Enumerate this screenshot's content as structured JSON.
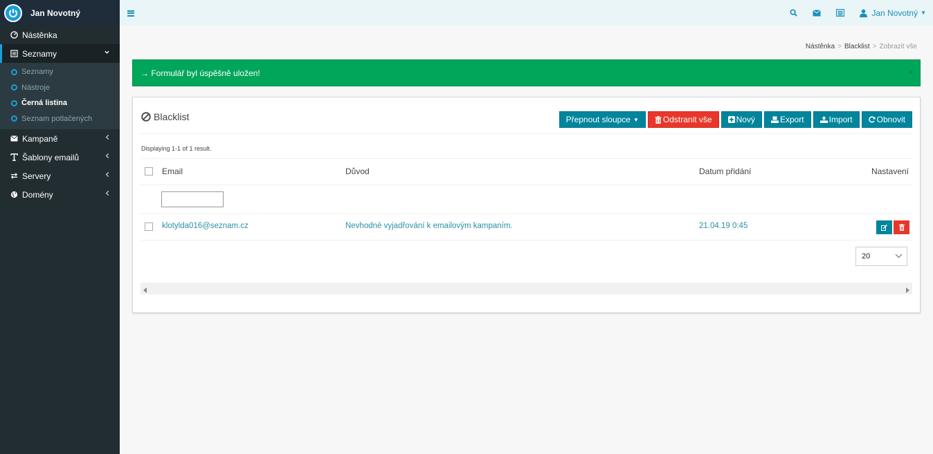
{
  "sidebar": {
    "brand": "Jan Novotný",
    "items": [
      {
        "label": "Nástěnka",
        "icon": "dashboard-icon"
      },
      {
        "label": "Seznamy",
        "icon": "list-icon"
      },
      {
        "label": "Kampaně",
        "icon": "envelope-icon"
      },
      {
        "label": "Šablony emailů",
        "icon": "text-icon"
      },
      {
        "label": "Servery",
        "icon": "exchange-icon"
      },
      {
        "label": "Domény",
        "icon": "globe-icon"
      }
    ],
    "sub_items": [
      "Seznamy",
      "Nástroje",
      "Černá listina",
      "Seznam potlačených"
    ]
  },
  "topbar": {
    "user": "Jan Novotný"
  },
  "breadcrumb": [
    "Nástěnka",
    "Blacklist",
    "Zobrazit vše"
  ],
  "alert": {
    "message": "→ Formulář byl úspěšně uložen!",
    "close": "×"
  },
  "box": {
    "title": "Blacklist",
    "buttons": {
      "toggle_columns": "Přepnout sloupce",
      "delete_all": "Odstranit vše",
      "new": "Nový",
      "export": "Export",
      "import": "Import",
      "refresh": "Obnovit"
    },
    "summary": "Displaying 1-1 of 1 result.",
    "columns": [
      "Email",
      "Důvod",
      "Datum přidání",
      "Nastavení"
    ],
    "rows": [
      {
        "email": "klotylda016@seznam.cz",
        "reason": "Nevhodné vyjadřování k emailovým kampaním.",
        "date": "21.04.19 0:45"
      }
    ],
    "page_size": "20"
  },
  "colors": {
    "sidebar": "#222d32",
    "accent": "#00859c",
    "danger": "#e8372a",
    "success": "#00a65a",
    "link": "#2c8fa6"
  }
}
